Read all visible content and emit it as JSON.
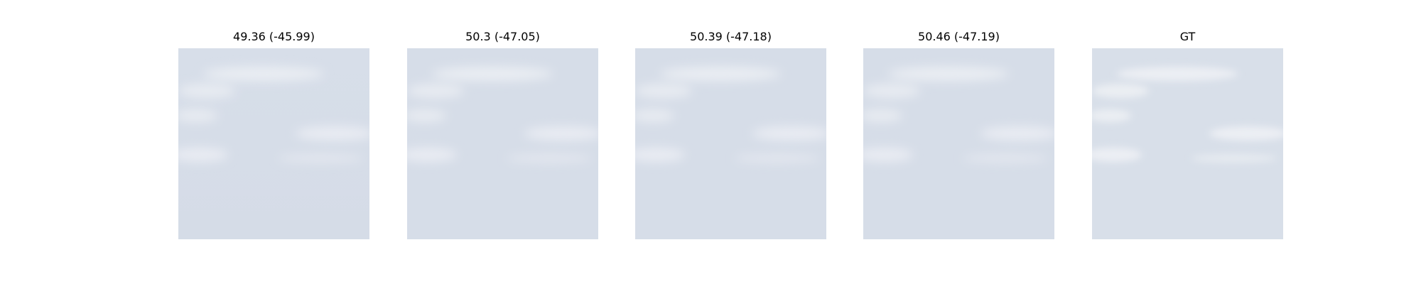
{
  "panels": [
    {
      "title": "49.36 (-45.99)",
      "image": "sky-cloud-reconstruction"
    },
    {
      "title": "50.3 (-47.05)",
      "image": "sky-cloud-reconstruction"
    },
    {
      "title": "50.39 (-47.18)",
      "image": "sky-cloud-reconstruction"
    },
    {
      "title": "50.46 (-47.19)",
      "image": "sky-cloud-reconstruction"
    },
    {
      "title": "GT",
      "image": "sky-cloud-ground-truth"
    }
  ],
  "colors": {
    "sky": "#d6dde8",
    "sky_light": "#dde3ec",
    "cloud": "#eceff4"
  }
}
